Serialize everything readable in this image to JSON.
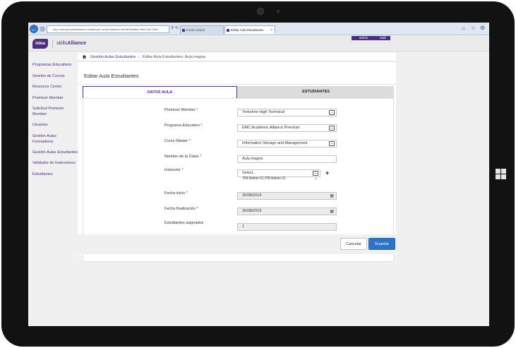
{
  "browser": {
    "url": "http://campus.skillsalliance.academy/CourseClassroom/Edit/35aa8a1-f9b4-4d72-8b7",
    "tabs": [
      {
        "label": "Iniciar sesión"
      },
      {
        "label": "Editar Aula Estudiantes"
      }
    ]
  },
  "header": {
    "logo_text": "inlea",
    "brand_prefix": "skills",
    "brand_suffix": "Alliance",
    "user": "admin",
    "logout": "Salir"
  },
  "sidebar": {
    "items": [
      {
        "label": "Programas Educativos"
      },
      {
        "label": "Gestión de Cursos"
      },
      {
        "label": "Resource Center"
      },
      {
        "label": "Premium Member"
      },
      {
        "label": "Solicitud Premium Member"
      },
      {
        "label": "Usuarios"
      },
      {
        "label": "Gestión Aulas Formadores"
      },
      {
        "label": "Gestión Aulas Estudiantes"
      },
      {
        "label": "Validador de Instructores"
      },
      {
        "label": "Estudiantes"
      }
    ]
  },
  "breadcrumb": {
    "link": "Gestión Aulas Estudiantes",
    "separator": "/",
    "current": "Editar Aula Estudiantes: Aula magna"
  },
  "page": {
    "title": "Editar Aula Estudiantes"
  },
  "form_tabs": [
    {
      "label": "DATOS AULA",
      "active": true
    },
    {
      "label": "ESTUDIANTES",
      "active": false
    }
  ],
  "form": {
    "premium_member": {
      "label": "Premium Member",
      "value": "Yorkshire High Technical"
    },
    "programa": {
      "label": "Programa Educativo",
      "value": "EMC Academic Alliance Premium"
    },
    "curso": {
      "label": "Curso Máster",
      "value": "Information Storage and Management"
    },
    "nombre": {
      "label": "Nombre de la Clase",
      "value": "Aula magna"
    },
    "instructor": {
      "label": "Instructor",
      "placeholder": "Select...",
      "selected": "PM Admin 01 PM Admin 01",
      "remove": "×"
    },
    "fecha_inicio": {
      "label": "Fecha inicio",
      "value": "26/08/2015"
    },
    "fecha_fin": {
      "label": "Fecha finalización",
      "value": "26/08/2015"
    },
    "asignados": {
      "label": "Estudiantes asignados",
      "value": "1"
    },
    "required_mark": "*"
  },
  "actions": {
    "cancel": "Cancelar",
    "save": "Guardar"
  },
  "colors": {
    "brand": "#4b2e83",
    "primary_button": "#2e74c6",
    "required": "#cc2222"
  }
}
